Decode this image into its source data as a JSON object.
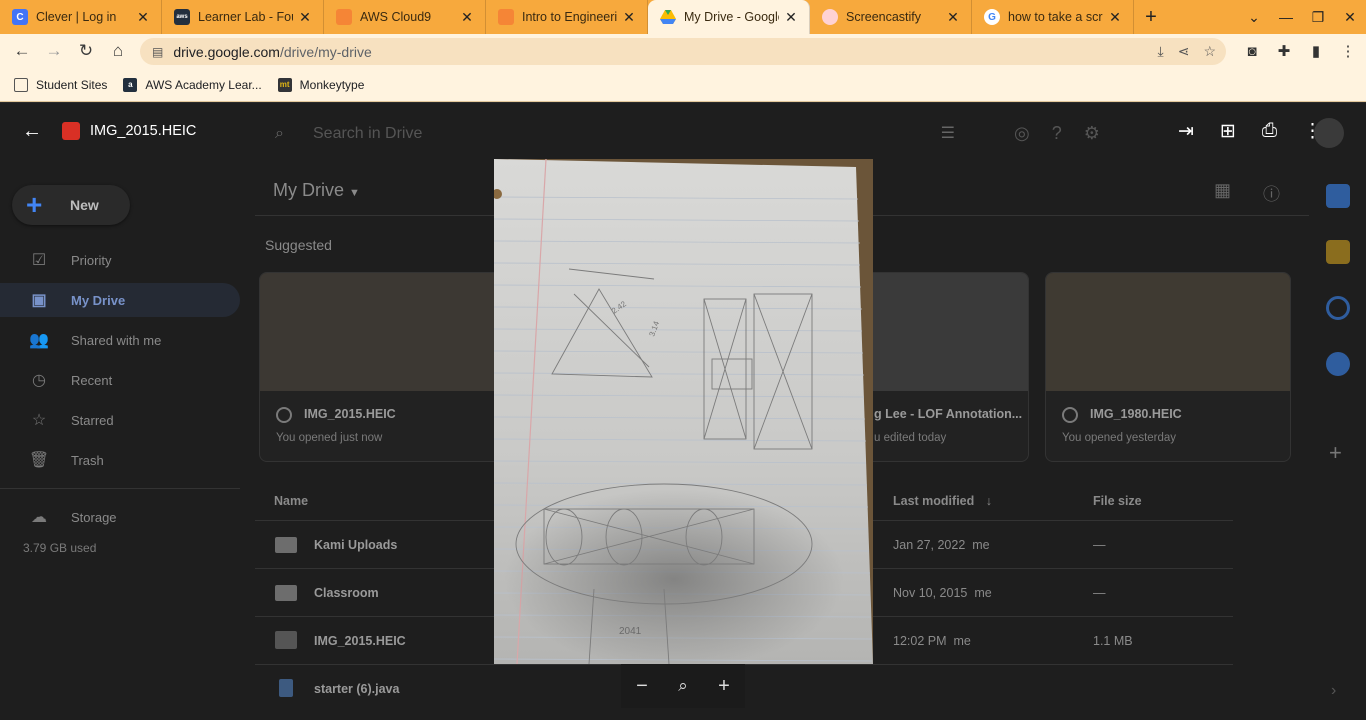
{
  "browser": {
    "tabs": [
      {
        "title": "Clever | Log in",
        "favicon": "clever-icon",
        "color": "#4274f6"
      },
      {
        "title": "Learner Lab - Foun",
        "favicon": "aws-icon",
        "color": "#232f3e"
      },
      {
        "title": "AWS Cloud9",
        "favicon": "cloud9-cube-icon",
        "color": "#f58536"
      },
      {
        "title": "Intro to Engineerin",
        "favicon": "cube-icon",
        "color": "#f58536"
      },
      {
        "title": "My Drive - Google D",
        "favicon": "google-drive-icon",
        "color": "#34a853"
      },
      {
        "title": "Screencastify",
        "favicon": "screencastify-icon",
        "color": "#ff5a5f"
      },
      {
        "title": "how to take a scre",
        "favicon": "google-icon",
        "color": "#4285f4"
      }
    ],
    "url_domain": "drive.google.com",
    "url_path": "/drive/my-drive",
    "bookmarks": [
      {
        "label": "Student Sites",
        "icon": "folder-icon"
      },
      {
        "label": "AWS Academy Lear...",
        "icon": "aws-icon"
      },
      {
        "label": "Monkeytype",
        "icon": "monkeytype-icon"
      }
    ]
  },
  "viewer": {
    "file_name": "IMG_2015.HEIC"
  },
  "drive": {
    "search_placeholder": "Search in Drive",
    "new_label": "New",
    "nav": [
      {
        "label": "Priority",
        "icon": "priority-check-icon"
      },
      {
        "label": "My Drive",
        "icon": "my-drive-icon",
        "selected": true
      },
      {
        "label": "Shared with me",
        "icon": "people-icon"
      },
      {
        "label": "Recent",
        "icon": "clock-icon"
      },
      {
        "label": "Starred",
        "icon": "star-icon"
      },
      {
        "label": "Trash",
        "icon": "trash-icon"
      }
    ],
    "storage_label": "Storage",
    "storage_used": "3.79 GB used",
    "title": "My Drive",
    "suggested_label": "Suggested",
    "cards": [
      {
        "name": "IMG_2015.HEIC",
        "sub": "You opened just now"
      },
      {
        "name": "g Lee - LOF Annotation...",
        "sub": "u edited today"
      },
      {
        "name": "IMG_1980.HEIC",
        "sub": "You opened yesterday"
      }
    ],
    "columns": {
      "name": "Name",
      "modified": "Last modified",
      "size": "File size"
    },
    "rows": [
      {
        "name": "Kami Uploads",
        "modified": "Jan 27, 2022",
        "owner": "me",
        "size": "—"
      },
      {
        "name": "Classroom",
        "modified": "Nov 10, 2015",
        "owner": "me",
        "size": "—"
      },
      {
        "name": "IMG_2015.HEIC",
        "modified": "12:02 PM",
        "owner": "me",
        "size": "1.1 MB"
      },
      {
        "name": "starter (6).java",
        "modified": "",
        "owner": "",
        "size": ""
      }
    ]
  },
  "sketch_labels": {
    "a": "2.42",
    "b": "3.14",
    "c": "2041"
  }
}
